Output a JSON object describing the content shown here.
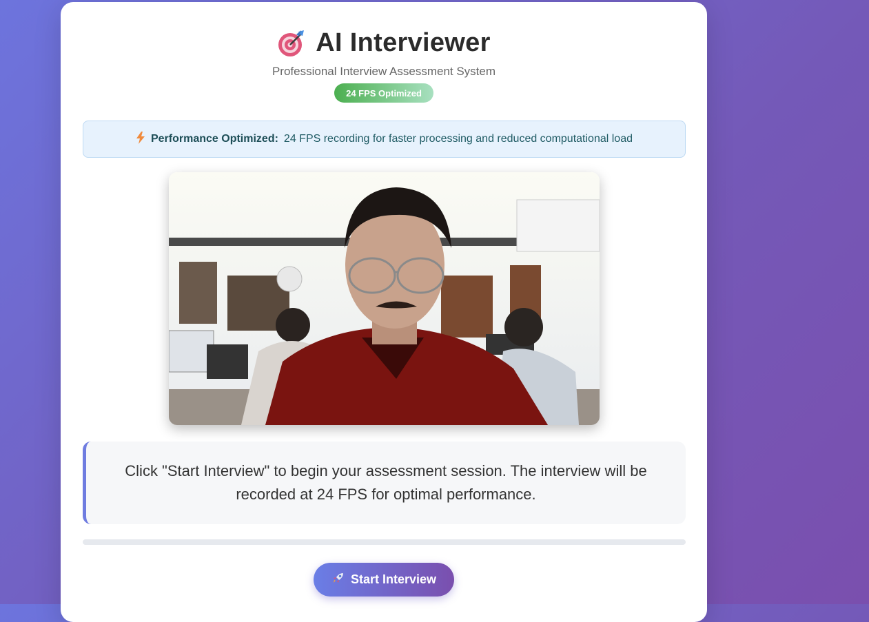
{
  "app": {
    "title": "AI Interviewer",
    "subtitle": "Professional Interview Assessment System",
    "fps_badge": "24 FPS Optimized",
    "title_icon": "target-dart-icon"
  },
  "performance_banner": {
    "icon": "lightning-icon",
    "label": "Performance Optimized:",
    "text": "24 FPS recording for faster processing and reduced computational load"
  },
  "video": {
    "content": "webcam-feed"
  },
  "notice": {
    "text": "Click \"Start Interview\" to begin your assessment session. The interview will be recorded at 24 FPS for optimal performance."
  },
  "progress": {
    "value": 0
  },
  "actions": {
    "start_icon": "rocket-icon",
    "start_label": "Start Interview"
  },
  "colors": {
    "accent_start": "#6a7ee6",
    "accent_end": "#7a4fae",
    "badge_green": "#4caf50",
    "banner_bg": "#e7f2fd"
  }
}
